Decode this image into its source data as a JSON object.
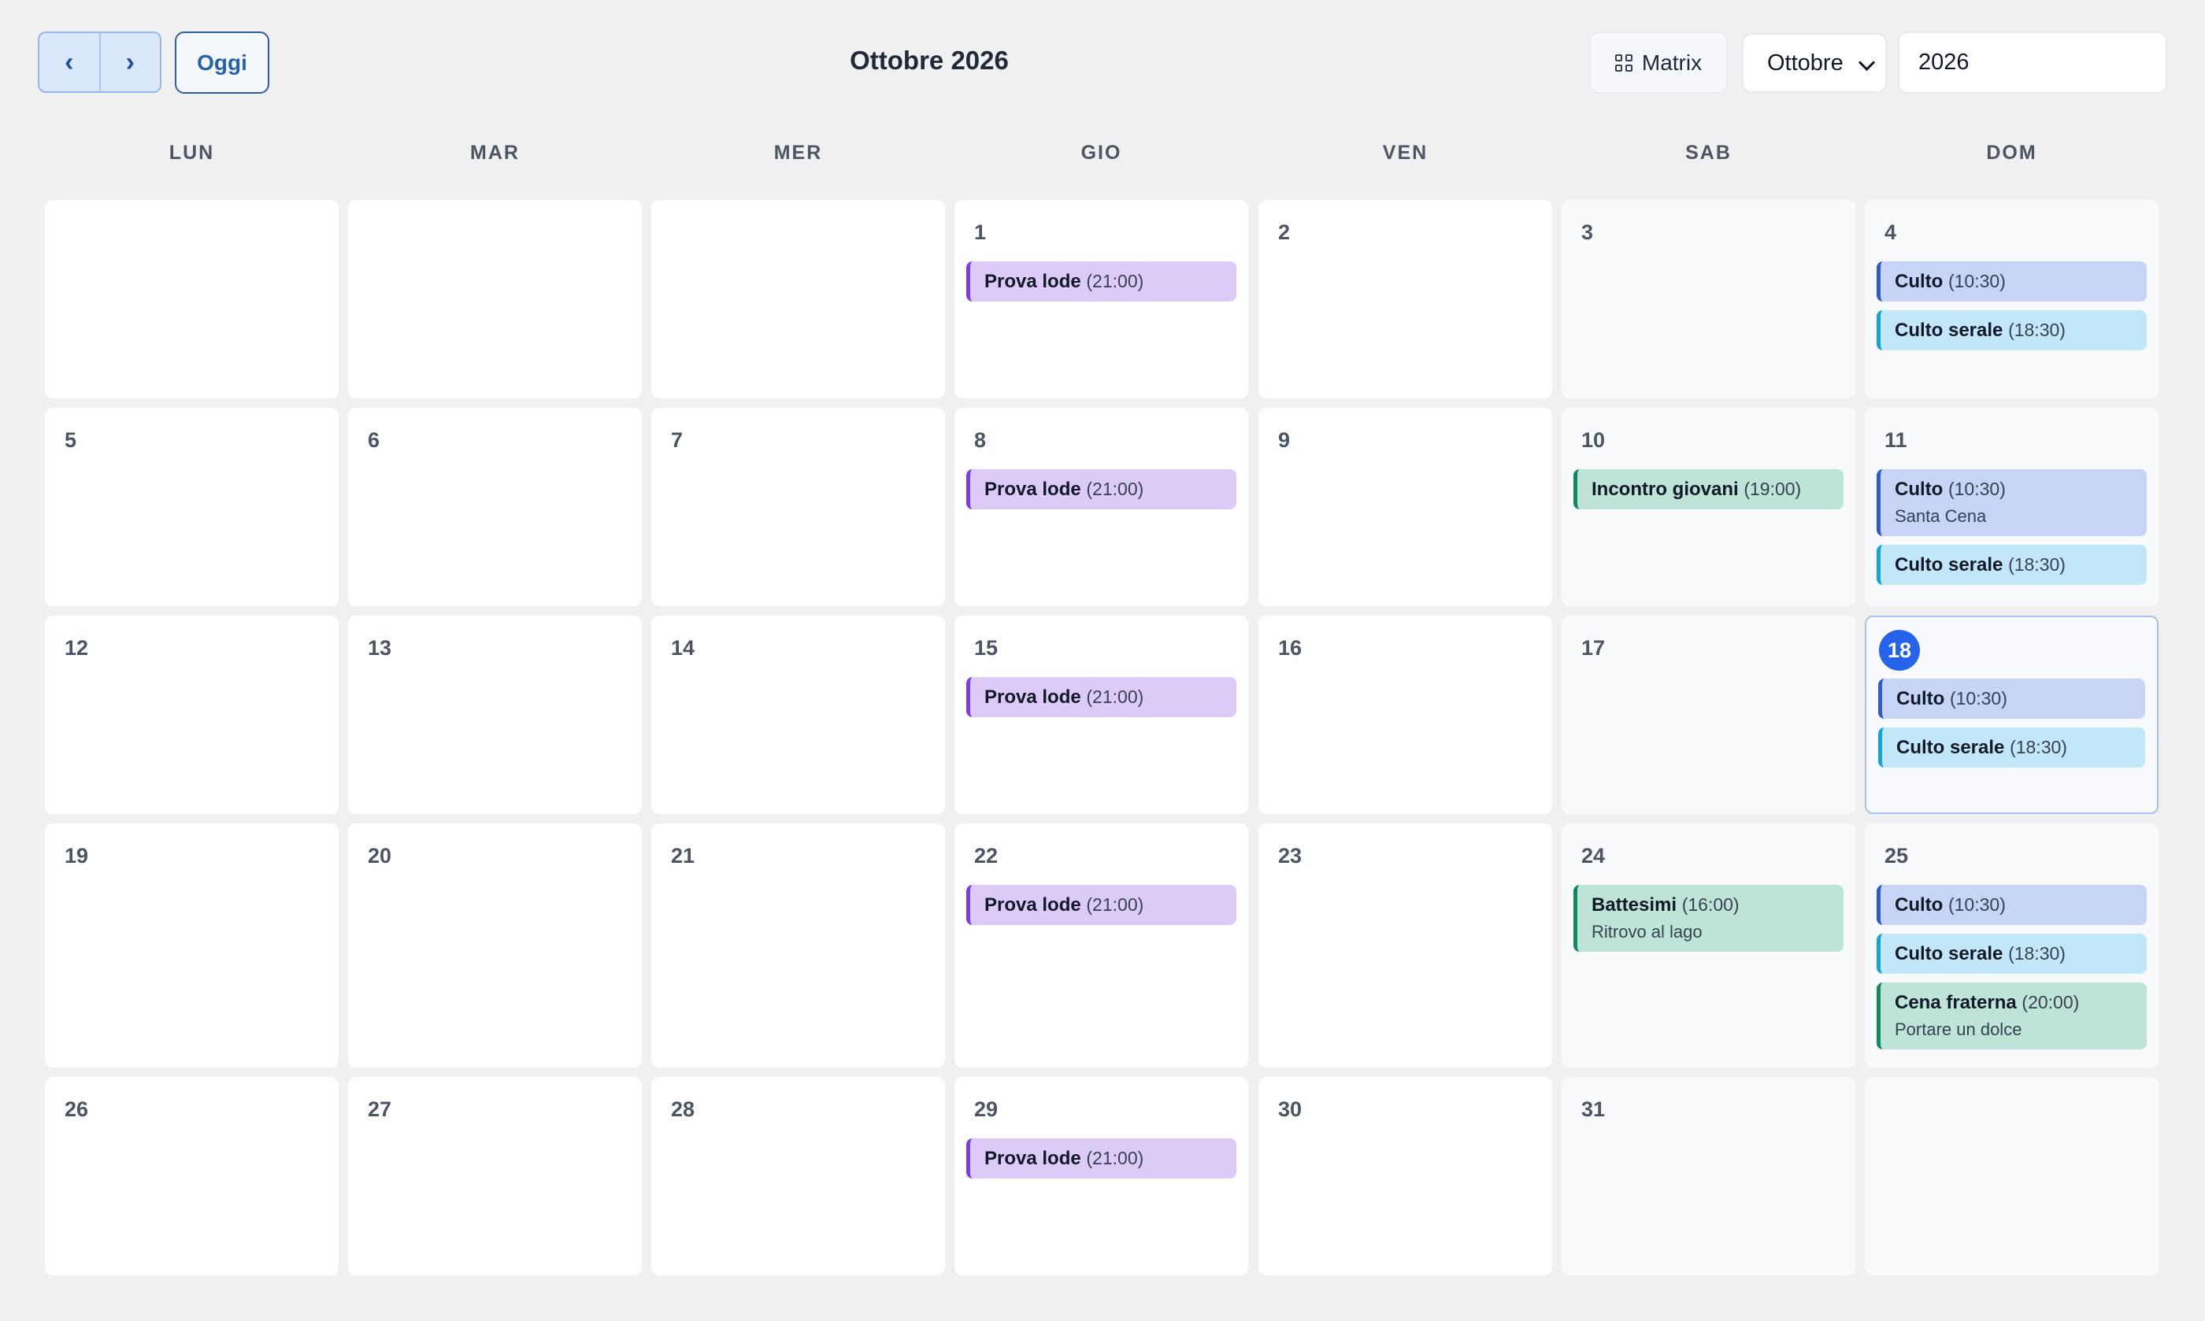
{
  "toolbar": {
    "prev_label": "‹",
    "next_label": "›",
    "today_label": "Oggi",
    "title": "Ottobre 2026",
    "matrix_label": "Matrix",
    "month_select": "Ottobre",
    "year_value": "2026"
  },
  "weekdays": [
    "LUN",
    "MAR",
    "MER",
    "GIO",
    "VEN",
    "SAB",
    "DOM"
  ],
  "today_day": 18,
  "weeks": [
    [
      null,
      null,
      null,
      {
        "day": "1",
        "events": [
          {
            "title": "Prova lode",
            "time": "(21:00)",
            "color": "purple"
          }
        ]
      },
      {
        "day": "2",
        "events": []
      },
      {
        "day": "3",
        "events": []
      },
      {
        "day": "4",
        "events": [
          {
            "title": "Culto",
            "time": "(10:30)",
            "color": "blue"
          },
          {
            "title": "Culto serale",
            "time": "(18:30)",
            "color": "cyan"
          }
        ]
      }
    ],
    [
      {
        "day": "5",
        "events": []
      },
      {
        "day": "6",
        "events": []
      },
      {
        "day": "7",
        "events": []
      },
      {
        "day": "8",
        "events": [
          {
            "title": "Prova lode",
            "time": "(21:00)",
            "color": "purple"
          }
        ]
      },
      {
        "day": "9",
        "events": []
      },
      {
        "day": "10",
        "events": [
          {
            "title": "Incontro giovani",
            "time": "(19:00)",
            "color": "green"
          }
        ]
      },
      {
        "day": "11",
        "events": [
          {
            "title": "Culto",
            "time": "(10:30)",
            "note": "Santa Cena",
            "color": "blue"
          },
          {
            "title": "Culto serale",
            "time": "(18:30)",
            "color": "cyan"
          }
        ]
      }
    ],
    [
      {
        "day": "12",
        "events": []
      },
      {
        "day": "13",
        "events": []
      },
      {
        "day": "14",
        "events": []
      },
      {
        "day": "15",
        "events": [
          {
            "title": "Prova lode",
            "time": "(21:00)",
            "color": "purple"
          }
        ]
      },
      {
        "day": "16",
        "events": []
      },
      {
        "day": "17",
        "events": []
      },
      {
        "day": "18",
        "events": [
          {
            "title": "Culto",
            "time": "(10:30)",
            "color": "blue"
          },
          {
            "title": "Culto serale",
            "time": "(18:30)",
            "color": "cyan"
          }
        ]
      }
    ],
    [
      {
        "day": "19",
        "events": []
      },
      {
        "day": "20",
        "events": []
      },
      {
        "day": "21",
        "events": []
      },
      {
        "day": "22",
        "events": [
          {
            "title": "Prova lode",
            "time": "(21:00)",
            "color": "purple"
          }
        ]
      },
      {
        "day": "23",
        "events": []
      },
      {
        "day": "24",
        "events": [
          {
            "title": "Battesimi",
            "time": "(16:00)",
            "note": "Ritrovo al lago",
            "color": "green"
          }
        ]
      },
      {
        "day": "25",
        "events": [
          {
            "title": "Culto",
            "time": "(10:30)",
            "color": "blue"
          },
          {
            "title": "Culto serale",
            "time": "(18:30)",
            "color": "cyan"
          },
          {
            "title": "Cena fraterna",
            "time": "(20:00)",
            "note": "Portare un dolce",
            "color": "green"
          }
        ]
      }
    ],
    [
      {
        "day": "26",
        "events": []
      },
      {
        "day": "27",
        "events": []
      },
      {
        "day": "28",
        "events": []
      },
      {
        "day": "29",
        "events": [
          {
            "title": "Prova lode",
            "time": "(21:00)",
            "color": "purple"
          }
        ]
      },
      {
        "day": "30",
        "events": []
      },
      {
        "day": "31",
        "events": []
      },
      null
    ]
  ]
}
